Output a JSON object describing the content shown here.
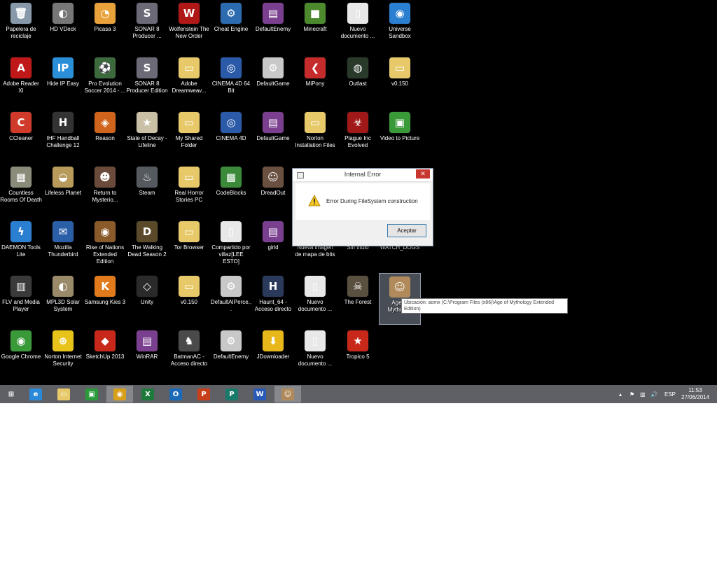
{
  "desktop": {
    "icons": [
      {
        "label": "Papelera de reciclaje",
        "icon": "recycle-bin-icon",
        "glyph": "🗑",
        "color": "#8899aa",
        "shortcut": false
      },
      {
        "label": "HD VDeck",
        "icon": "hd-vdeck-icon",
        "glyph": "◐",
        "color": "#777777",
        "shortcut": true
      },
      {
        "label": "Picasa 3",
        "icon": "picasa-icon",
        "glyph": "◔",
        "color": "#e9a23b",
        "shortcut": true
      },
      {
        "label": "SONAR 8 Producer ...",
        "icon": "sonar-icon",
        "glyph": "S",
        "color": "#6d6a78",
        "shortcut": true
      },
      {
        "label": "Wolfenstein The New Order",
        "icon": "wolfenstein-icon",
        "glyph": "W",
        "color": "#b01818",
        "shortcut": true
      },
      {
        "label": "Cheat Engine",
        "icon": "cheat-engine-icon",
        "glyph": "⚙",
        "color": "#2c6bb0",
        "shortcut": true
      },
      {
        "label": "DefaultEnemy",
        "icon": "winrar-archive-icon",
        "glyph": "▤",
        "color": "#7a3f8f",
        "shortcut": true
      },
      {
        "label": "Minecraft",
        "icon": "minecraft-icon",
        "glyph": "■",
        "color": "#4d8a2e",
        "shortcut": true
      },
      {
        "label": "Nuevo documento ...",
        "icon": "document-icon",
        "glyph": "▯",
        "color": "#e8e8e8",
        "shortcut": true
      },
      {
        "label": "Universe Sandbox",
        "icon": "universe-sandbox-icon",
        "glyph": "◉",
        "color": "#2a7fd1",
        "shortcut": true
      },
      {
        "label": "Adobe Reader XI",
        "icon": "adobe-reader-icon",
        "glyph": "A",
        "color": "#c01818",
        "shortcut": true
      },
      {
        "label": "Hide IP Easy",
        "icon": "hide-ip-icon",
        "glyph": "IP",
        "color": "#2a8fd8",
        "shortcut": true
      },
      {
        "label": "Pro Evolution Soccer 2014 - ...",
        "icon": "pes-icon",
        "glyph": "⚽",
        "color": "#3c6a3c",
        "shortcut": true
      },
      {
        "label": "SONAR 8 Producer Edition",
        "icon": "sonar-icon",
        "glyph": "S",
        "color": "#6d6a78",
        "shortcut": true
      },
      {
        "label": "Adobe Dreamweav...",
        "icon": "folder-icon",
        "glyph": "▭",
        "color": "#e8c96a",
        "shortcut": false
      },
      {
        "label": "CINEMA 4D 64 Bit",
        "icon": "cinema4d-icon",
        "glyph": "◎",
        "color": "#2b5aa8",
        "shortcut": true
      },
      {
        "label": "DefaultGame",
        "icon": "config-file-icon",
        "glyph": "⚙",
        "color": "#c8c8c8",
        "shortcut": true
      },
      {
        "label": "MiPony",
        "icon": "mipony-icon",
        "glyph": "❮",
        "color": "#c62b2b",
        "shortcut": true
      },
      {
        "label": "Outlast",
        "icon": "outlast-icon",
        "glyph": "◍",
        "color": "#2a3a2a",
        "shortcut": true
      },
      {
        "label": "v0.150",
        "icon": "zip-folder-icon",
        "glyph": "▭",
        "color": "#e8c96a",
        "shortcut": false
      },
      {
        "label": "CCleaner",
        "icon": "ccleaner-icon",
        "glyph": "C",
        "color": "#d03a2a",
        "shortcut": true
      },
      {
        "label": "IHF Handball Challenge 12",
        "icon": "handball-icon",
        "glyph": "H",
        "color": "#333333",
        "shortcut": true
      },
      {
        "label": "Reason",
        "icon": "reason-icon",
        "glyph": "◈",
        "color": "#d0641c",
        "shortcut": true
      },
      {
        "label": "State of Decay - Lifeline",
        "icon": "state-of-decay-icon",
        "glyph": "★",
        "color": "#c9c0a6",
        "shortcut": true
      },
      {
        "label": "My Shared Folder",
        "icon": "folder-icon",
        "glyph": "▭",
        "color": "#e8c96a",
        "shortcut": false
      },
      {
        "label": "CINEMA 4D",
        "icon": "cinema4d-icon",
        "glyph": "◎",
        "color": "#2b5aa8",
        "shortcut": true
      },
      {
        "label": "DefaultGame",
        "icon": "winrar-archive-icon",
        "glyph": "▤",
        "color": "#7a3f8f",
        "shortcut": true
      },
      {
        "label": "Norton Installation Files",
        "icon": "folder-icon",
        "glyph": "▭",
        "color": "#e8c96a",
        "shortcut": false
      },
      {
        "label": "Plague Inc Evolved",
        "icon": "plague-inc-icon",
        "glyph": "☣",
        "color": "#a01818",
        "shortcut": true
      },
      {
        "label": "Video to Picture",
        "icon": "video-to-picture-icon",
        "glyph": "▣",
        "color": "#3a9a3a",
        "shortcut": true
      },
      {
        "label": "Countless Rooms Of Death",
        "icon": "countless-rooms-icon",
        "glyph": "▦",
        "color": "#8b8b7a",
        "shortcut": true
      },
      {
        "label": "Lifeless Planet",
        "icon": "lifeless-planet-icon",
        "glyph": "◒",
        "color": "#b89a5a",
        "shortcut": true
      },
      {
        "label": "Return to Mysterio...",
        "icon": "return-to-mysterious-icon",
        "glyph": "☻",
        "color": "#6a4a3a",
        "shortcut": true
      },
      {
        "label": "Steam",
        "icon": "steam-icon",
        "glyph": "♨",
        "color": "#555a60",
        "shortcut": true
      },
      {
        "label": "Real Horror Stories PC",
        "icon": "folder-icon",
        "glyph": "▭",
        "color": "#e8c96a",
        "shortcut": false
      },
      {
        "label": "CodeBlocks",
        "icon": "codeblocks-icon",
        "glyph": "▩",
        "color": "#3a8a3a",
        "shortcut": true
      },
      {
        "label": "DreadOut",
        "icon": "dreadout-icon",
        "glyph": "☺",
        "color": "#6a5040",
        "shortcut": true
      },
      {
        "label": "",
        "icon": "blank-icon",
        "glyph": "",
        "color": "#000000",
        "shortcut": false
      },
      {
        "label": "",
        "icon": "blank-icon",
        "glyph": "",
        "color": "#000000",
        "shortcut": false
      },
      {
        "label": "",
        "icon": "blank-icon",
        "glyph": "",
        "color": "#000000",
        "shortcut": false
      },
      {
        "label": "DAEMON Tools Lite",
        "icon": "daemon-tools-icon",
        "glyph": "ϟ",
        "color": "#2a7fd1",
        "shortcut": true
      },
      {
        "label": "Mozilla Thunderbird",
        "icon": "thunderbird-icon",
        "glyph": "✉",
        "color": "#2a5fa8",
        "shortcut": true
      },
      {
        "label": "Rise of Nations Extended Edition",
        "icon": "rise-of-nations-icon",
        "glyph": "◉",
        "color": "#8a5a2a",
        "shortcut": true
      },
      {
        "label": "The Walking Dead Season 2",
        "icon": "walking-dead-icon",
        "glyph": "D",
        "color": "#5a4a2a",
        "shortcut": true
      },
      {
        "label": "Tor Browser",
        "icon": "folder-icon",
        "glyph": "▭",
        "color": "#e8c96a",
        "shortcut": false
      },
      {
        "label": "Compartido por villaz[LEE ESTO]",
        "icon": "document-icon",
        "glyph": "▯",
        "color": "#e8e8e8",
        "shortcut": false
      },
      {
        "label": "girld",
        "icon": "winrar-archive-icon",
        "glyph": "▤",
        "color": "#7a3f8f",
        "shortcut": true
      },
      {
        "label": "Nueva imagen de mapa de bits",
        "icon": "bitmap-icon",
        "glyph": "",
        "color": "#000000",
        "shortcut": false
      },
      {
        "label": "Sin título",
        "icon": "blank-icon",
        "glyph": "",
        "color": "#000000",
        "shortcut": false
      },
      {
        "label": "WATCH_DOGS",
        "icon": "watch-dogs-icon",
        "glyph": "",
        "color": "#000000",
        "shortcut": false
      },
      {
        "label": "FLV and Media Player",
        "icon": "flv-player-icon",
        "glyph": "▥",
        "color": "#3a3a3a",
        "shortcut": true
      },
      {
        "label": "MPL3D Solar System",
        "icon": "solar-system-icon",
        "glyph": "◐",
        "color": "#9a8a6a",
        "shortcut": true
      },
      {
        "label": "Samsung Kies 3",
        "icon": "samsung-kies-icon",
        "glyph": "K",
        "color": "#e07a1a",
        "shortcut": true
      },
      {
        "label": "Unity",
        "icon": "unity-icon",
        "glyph": "◇",
        "color": "#2a2a2a",
        "shortcut": true
      },
      {
        "label": "v0.150",
        "icon": "folder-icon",
        "glyph": "▭",
        "color": "#e8c96a",
        "shortcut": false
      },
      {
        "label": "DefaultAIPerce...",
        "icon": "config-file-icon",
        "glyph": "⚙",
        "color": "#c8c8c8",
        "shortcut": true
      },
      {
        "label": "Haunt_64 - Acceso directo",
        "icon": "haunt-icon",
        "glyph": "H",
        "color": "#2a3a5a",
        "shortcut": true
      },
      {
        "label": "Nuevo documento ...",
        "icon": "document-icon",
        "glyph": "▯",
        "color": "#e8e8e8",
        "shortcut": false
      },
      {
        "label": "The Forest",
        "icon": "the-forest-icon",
        "glyph": "☠",
        "color": "#5a5040",
        "shortcut": true
      },
      {
        "label": "Age of Mytholo...",
        "icon": "age-of-mythology-icon",
        "glyph": "☺",
        "color": "#b08a5a",
        "shortcut": true
      },
      {
        "label": "Google Chrome",
        "icon": "chrome-icon",
        "glyph": "◉",
        "color": "#3a9a3a",
        "shortcut": true
      },
      {
        "label": "Norton Internet Security",
        "icon": "norton-icon",
        "glyph": "⊕",
        "color": "#e8c41a",
        "shortcut": true
      },
      {
        "label": "SketchUp 2013",
        "icon": "sketchup-icon",
        "glyph": "◆",
        "color": "#c8281a",
        "shortcut": true
      },
      {
        "label": "WinRAR",
        "icon": "winrar-icon",
        "glyph": "▤",
        "color": "#7a3f8f",
        "shortcut": true
      },
      {
        "label": "BatmanAC - Acceso directo",
        "icon": "batman-icon",
        "glyph": "♞",
        "color": "#4a4a4a",
        "shortcut": true
      },
      {
        "label": "DefaultEnemy",
        "icon": "config-file-icon",
        "glyph": "⚙",
        "color": "#c8c8c8",
        "shortcut": true
      },
      {
        "label": "JDownloader",
        "icon": "jdownloader-icon",
        "glyph": "⬇",
        "color": "#e8b81a",
        "shortcut": true
      },
      {
        "label": "Nuevo documento ...",
        "icon": "document-icon",
        "glyph": "▯",
        "color": "#e8e8e8",
        "shortcut": false
      },
      {
        "label": "Tropico 5",
        "icon": "tropico-icon",
        "glyph": "★",
        "color": "#c8281a",
        "shortcut": true
      }
    ],
    "selected_index": 59
  },
  "dialog": {
    "title": "Internal Error",
    "message": "Error During FileSystem construction",
    "ok_label": "Aceptar",
    "close_label": "✕"
  },
  "tooltip": {
    "text": "Ubicación: aomx (C:\\Program Files (x86)\\Age of Mythology Extended Edition)"
  },
  "taskbar": {
    "apps": [
      {
        "name": "start-button",
        "icon": "windows-logo-icon",
        "glyph": "⊞",
        "color": "#5e6066"
      },
      {
        "name": "taskbar-ie",
        "icon": "internet-explorer-icon",
        "glyph": "e",
        "color": "#2a8ad8"
      },
      {
        "name": "taskbar-explorer",
        "icon": "file-explorer-icon",
        "glyph": "▭",
        "color": "#e8c96a"
      },
      {
        "name": "taskbar-store",
        "icon": "store-icon",
        "glyph": "▣",
        "color": "#2a9a3a"
      },
      {
        "name": "taskbar-chrome",
        "icon": "chrome-icon",
        "glyph": "◉",
        "color": "#d8a01a"
      },
      {
        "name": "taskbar-excel",
        "icon": "excel-icon",
        "glyph": "X",
        "color": "#1d7a3a"
      },
      {
        "name": "taskbar-outlook",
        "icon": "outlook-icon",
        "glyph": "O",
        "color": "#1a6ab8"
      },
      {
        "name": "taskbar-powerpoint",
        "icon": "powerpoint-icon",
        "glyph": "P",
        "color": "#c8401a"
      },
      {
        "name": "taskbar-publisher",
        "icon": "publisher-icon",
        "glyph": "P",
        "color": "#1a7a6a"
      },
      {
        "name": "taskbar-word",
        "icon": "word-icon",
        "glyph": "W",
        "color": "#2a5ab8"
      },
      {
        "name": "taskbar-age-of-mythology",
        "icon": "age-of-mythology-icon",
        "glyph": "☺",
        "color": "#b08a5a"
      }
    ],
    "active_index": 4,
    "running_index": 10,
    "tray": {
      "up_arrow": "▴",
      "flag": "⚑",
      "network": "▥",
      "volume": "🔊",
      "language": "ESP"
    },
    "time": "11:53",
    "date": "27/06/2014"
  }
}
